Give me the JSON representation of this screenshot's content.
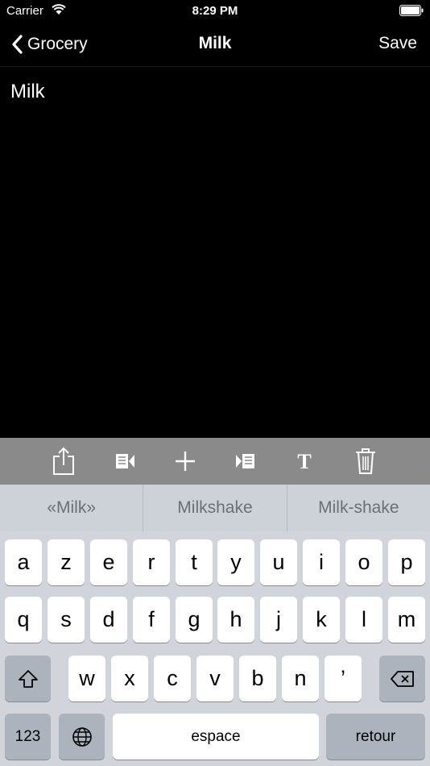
{
  "status": {
    "carrier": "Carrier",
    "time": "8:29 PM"
  },
  "nav": {
    "back_label": "Grocery",
    "title": "Milk",
    "save_label": "Save"
  },
  "note": {
    "text": "Milk"
  },
  "toolbar": {
    "icons": [
      "share-icon",
      "previous-note-icon",
      "add-icon",
      "next-note-icon",
      "text-format-icon",
      "trash-icon"
    ]
  },
  "suggestions": [
    "«Milk»",
    "Milkshake",
    "Milk-shake"
  ],
  "keyboard": {
    "row1": [
      "a",
      "z",
      "e",
      "r",
      "t",
      "y",
      "u",
      "i",
      "o",
      "p"
    ],
    "row2": [
      "q",
      "s",
      "d",
      "f",
      "g",
      "h",
      "j",
      "k",
      "l",
      "m"
    ],
    "row3": [
      "w",
      "x",
      "c",
      "v",
      "b",
      "n",
      "’"
    ],
    "numbers_label": "123",
    "space_label": "espace",
    "return_label": "retour"
  },
  "colors": {
    "background": "#000000",
    "toolbar": "#8a8a8a",
    "keyboard": "#d1d5db",
    "special_key": "#acb3bd"
  }
}
